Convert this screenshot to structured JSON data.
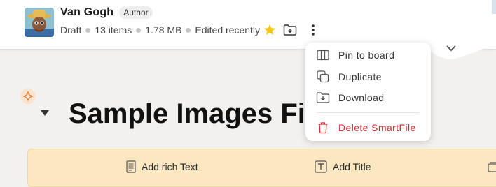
{
  "header": {
    "user_name": "Van Gogh",
    "role_badge": "Author",
    "meta": {
      "status": "Draft",
      "item_count": "13 items",
      "size": "1.78 MB",
      "edited": "Edited recently"
    },
    "icons": [
      "star-icon",
      "download-folder-icon",
      "more-vertical-icon",
      "chevron-down-icon"
    ]
  },
  "document": {
    "title": "Sample Images Fi"
  },
  "toolbar": {
    "add_rich_text": "Add rich Text",
    "add_title": "Add Title"
  },
  "menu": {
    "items": [
      {
        "label": "Pin to board",
        "icon": "pin-board-icon"
      },
      {
        "label": "Duplicate",
        "icon": "duplicate-icon"
      },
      {
        "label": "Download",
        "icon": "download-icon"
      },
      {
        "label": "Delete SmartFile",
        "icon": "trash-icon"
      }
    ]
  },
  "colors": {
    "danger": "#d6282f",
    "toolbar_bg": "#fbe8c1",
    "star": "#f5c518",
    "page_bg": "#f3f1ef"
  }
}
